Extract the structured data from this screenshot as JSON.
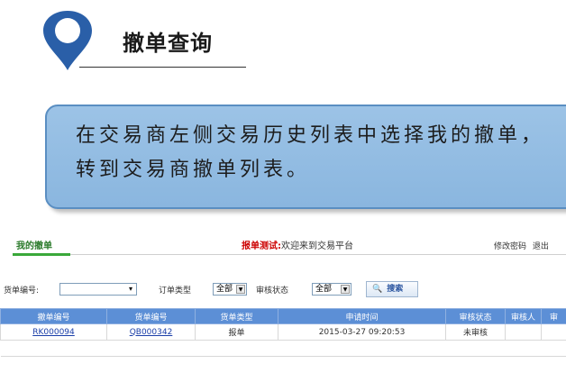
{
  "header": {
    "title": "撤单查询"
  },
  "callout": {
    "text": "在交易商左侧交易历史列表中选择我的撤单，转到交易商撤单列表。"
  },
  "app": {
    "tab": "我的撤单",
    "welcome_highlight": "报单测试:",
    "welcome_text": "欢迎来到交易平台",
    "link_change_password": "修改密码",
    "link_logout": "退出"
  },
  "filters": {
    "order_no_label": "货单编号:",
    "order_no_value": "",
    "order_type_label": "订单类型",
    "order_type_value": "全部",
    "review_status_label": "审核状态",
    "review_status_value": "全部",
    "search_label": "搜索"
  },
  "table": {
    "headers": [
      "撤单编号",
      "货单编号",
      "货单类型",
      "申请时间",
      "审核状态",
      "审核人",
      "审"
    ],
    "rows": [
      [
        "RK000094",
        "QB000342",
        "报单",
        "2015-03-27 09:20:53",
        "未审核",
        "",
        ""
      ]
    ]
  }
}
